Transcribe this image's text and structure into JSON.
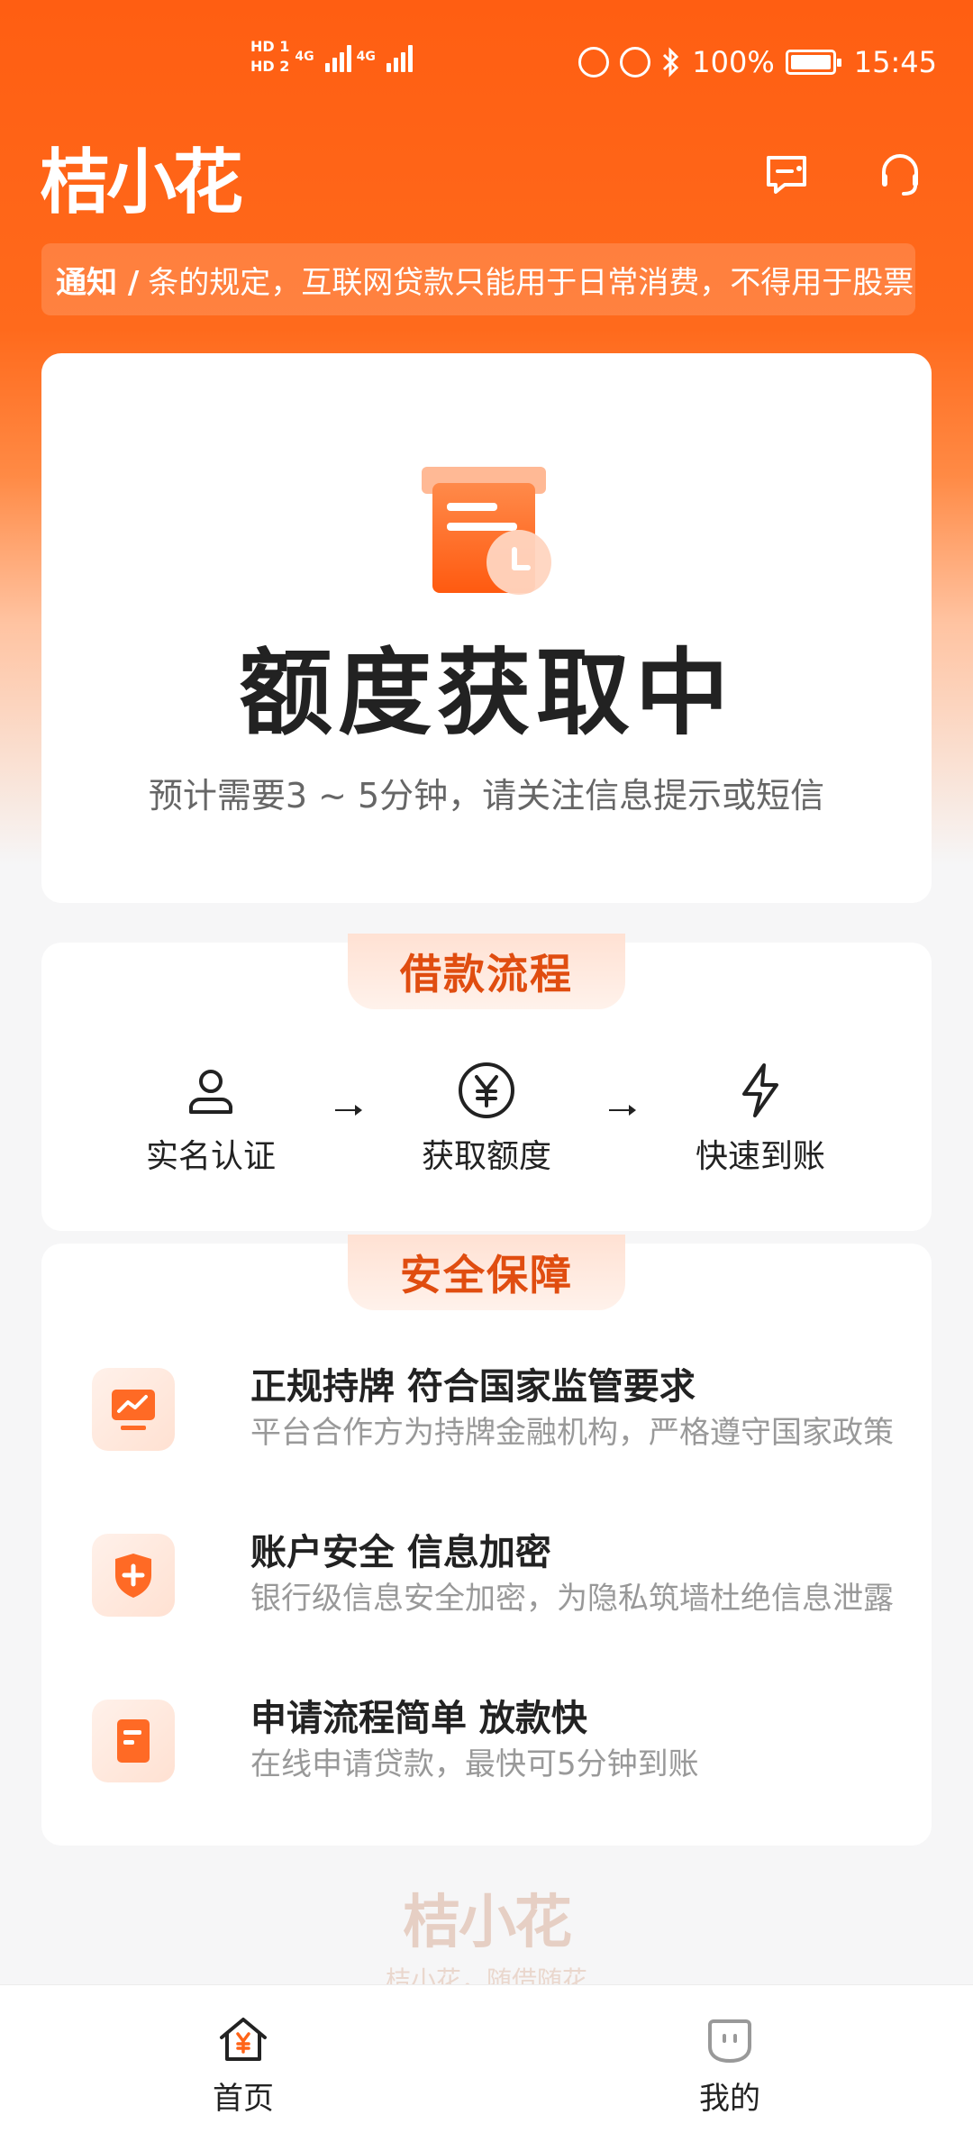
{
  "status_bar": {
    "hd1": "HD 1",
    "hd2": "HD 2",
    "net1": "4G",
    "net2": "4G",
    "battery": "100%",
    "time": "15:45"
  },
  "header": {
    "logo": "桔小花",
    "message_icon": "message-icon",
    "service_icon": "headset-icon"
  },
  "notice": {
    "label": "通知 /",
    "text": "条的规定，互联网贷款只能用于日常消费，不得用于股票"
  },
  "status_card": {
    "title": "额度获取中",
    "subtitle": "预计需要3 ~ 5分钟，请关注信息提示或短信"
  },
  "flow": {
    "title": "借款流程",
    "steps": [
      {
        "label": "实名认证",
        "icon": "user-icon"
      },
      {
        "label": "获取额度",
        "icon": "yuan-icon"
      },
      {
        "label": "快速到账",
        "icon": "lightning-icon"
      }
    ]
  },
  "safety": {
    "title": "安全保障",
    "items": [
      {
        "title": "正规持牌 符合国家监管要求",
        "desc": "平台合作方为持牌金融机构，严格遵守国家政策",
        "icon": "chart-icon"
      },
      {
        "title": "账户安全 信息加密",
        "desc": "银行级信息安全加密，为隐私筑墙杜绝信息泄露",
        "icon": "shield-icon"
      },
      {
        "title": "申请流程简单 放款快",
        "desc": "在线申请贷款，最快可5分钟到账",
        "icon": "document-icon"
      }
    ]
  },
  "footer": {
    "logo": "桔小花",
    "slogan": "桔小花，随借随花"
  },
  "tabbar": {
    "tabs": [
      {
        "label": "首页",
        "icon": "home-icon"
      },
      {
        "label": "我的",
        "icon": "profile-icon"
      }
    ]
  },
  "colors": {
    "brand": "#ff6418",
    "accent_text": "#e04d10"
  }
}
